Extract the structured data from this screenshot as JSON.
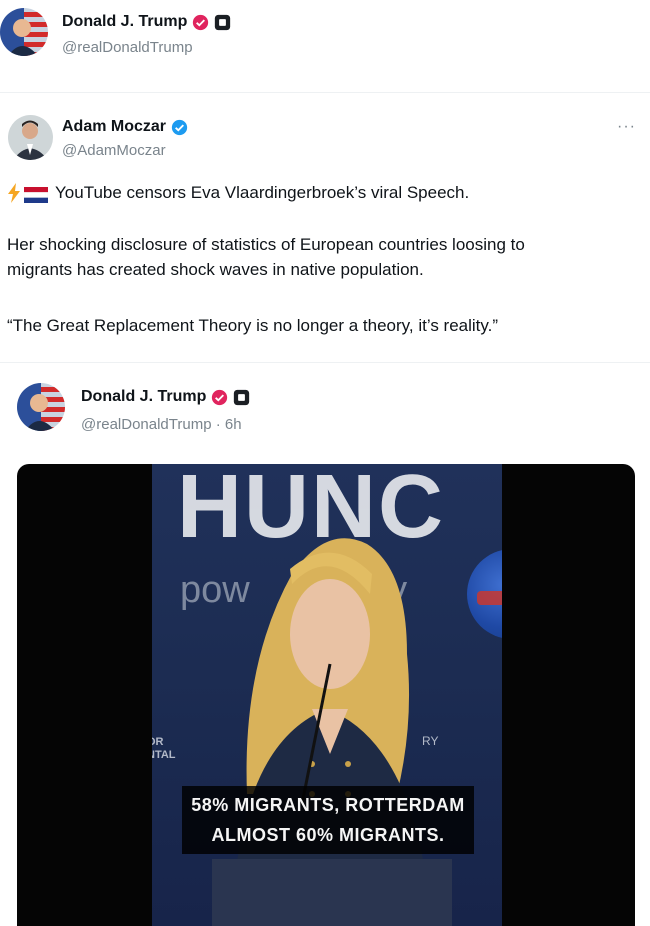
{
  "top_post": {
    "display_name": "Donald J. Trump",
    "handle": "@realDonaldTrump",
    "avatar_icon": "flag-portrait-avatar",
    "badge_icons": [
      "verified-badge-red",
      "square-affiliation-badge"
    ]
  },
  "main_post": {
    "display_name": "Adam Moczar",
    "handle": "@AdamMoczar",
    "avatar_icon": "portrait-avatar",
    "badge_icon": "verified-badge-blue",
    "more_label": "···",
    "line1_prefix_icons": [
      "lightning-icon",
      "netherlands-flag-icon"
    ],
    "line1": "YouTube censors Eva Vlaardingerbroek’s viral Speech.",
    "para2_line1": "Her shocking disclosure of statistics of European countries loosing to",
    "para2_line2": "migrants has created shock waves in native population.",
    "quote": "“The Great Replacement Theory is no longer a theory, it’s reality.”"
  },
  "quoted_post": {
    "display_name": "Donald J. Trump",
    "handle": "@realDonaldTrump · 6h",
    "avatar_icon": "flag-portrait-avatar",
    "badge_icons": [
      "verified-badge-red",
      "square-affiliation-badge"
    ]
  },
  "video": {
    "backdrop_word": "HUNC",
    "backdrop_left": "pow",
    "backdrop_right": "py",
    "side_left_line1": "OR",
    "side_left_line2": "NTAL",
    "side_right": "RY",
    "caption_line1": "58% MIGRANTS, ROTTERDAM",
    "caption_line2": "ALMOST 60% MIGRANTS."
  },
  "colors": {
    "verified_red": "#e0245e",
    "verified_blue": "#1d9bf0",
    "handle_gray": "#7a848c",
    "stage_blue": "#1c2c52"
  }
}
